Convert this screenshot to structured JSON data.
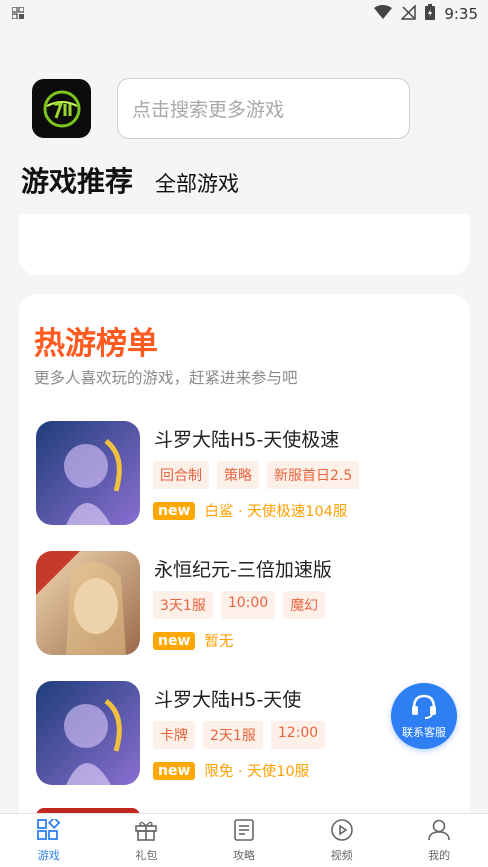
{
  "status_bar": {
    "time": "9:35"
  },
  "header": {
    "search_placeholder": "点击搜索更多游戏"
  },
  "tabs": [
    {
      "label": "游戏推荐",
      "active": true
    },
    {
      "label": "全部游戏",
      "active": false
    }
  ],
  "hot_list": {
    "title": "热游榜单",
    "subtitle": "更多人喜欢玩的游戏，赶紧进来参与吧",
    "games": [
      {
        "name": "斗罗大陆H5-天使极速",
        "tags": [
          "回合制",
          "策略",
          "新服首日2.5"
        ],
        "badge": "new",
        "info": "白鲨 · 天使极速104服",
        "icon_colors": [
          "#1f3d7a",
          "#8a6fd1"
        ]
      },
      {
        "name": "永恒纪元-三倍加速版",
        "tags": [
          "3天1服",
          "10:00",
          "魔幻"
        ],
        "badge": "new",
        "info": "暂无",
        "icon_colors": [
          "#c43b2a",
          "#f2d8b4"
        ]
      },
      {
        "name": "斗罗大陆H5-天使",
        "tags": [
          "卡牌",
          "2天1服",
          "12:00"
        ],
        "badge": "new",
        "info": "限免 · 天使10服",
        "icon_colors": [
          "#1f3d7a",
          "#8a6fd1"
        ]
      }
    ]
  },
  "customer_service": {
    "label": "联系客服",
    "icon": "headset-icon"
  },
  "bottom_nav": [
    {
      "label": "游戏",
      "icon": "grid-icon",
      "active": true
    },
    {
      "label": "礼包",
      "icon": "gift-icon",
      "active": false
    },
    {
      "label": "攻略",
      "icon": "article-icon",
      "active": false
    },
    {
      "label": "视频",
      "icon": "play-icon",
      "active": false
    },
    {
      "label": "我的",
      "icon": "user-icon",
      "active": false
    }
  ],
  "colors": {
    "accent": "#2d7ff3",
    "hot_title": "#ff5a1f",
    "tag_text": "#e7663f",
    "tag_bg": "#fdf0e9",
    "new_badge": "#ffa800"
  }
}
